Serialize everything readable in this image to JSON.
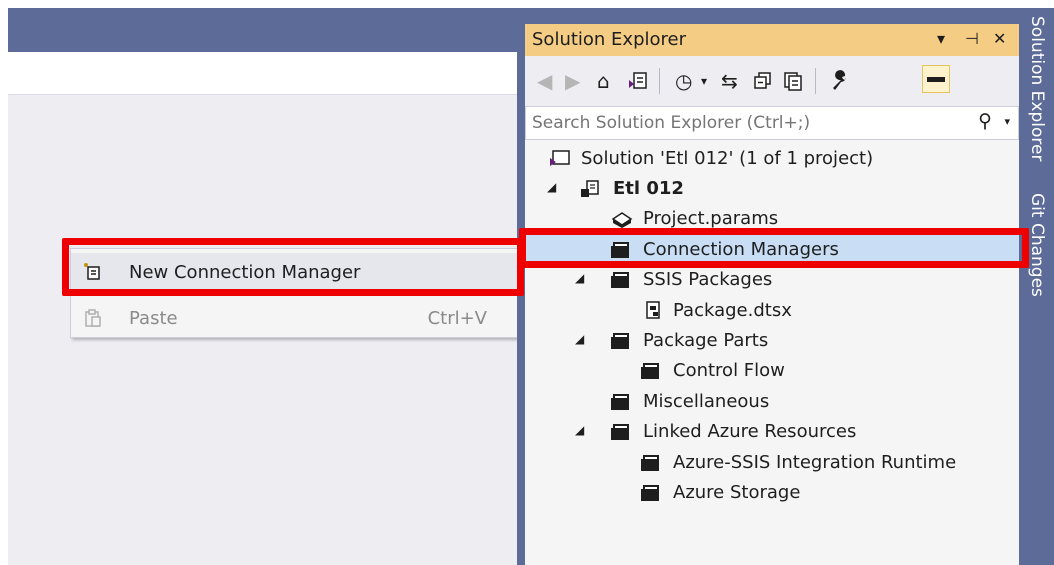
{
  "menu": {
    "items": [
      {
        "label": "New Connection Manager",
        "shortcut": "",
        "icon": "new-connection-icon",
        "enabled": true
      },
      {
        "label": "Paste",
        "shortcut": "Ctrl+V",
        "icon": "paste-icon",
        "enabled": false
      }
    ]
  },
  "solution_explorer": {
    "title": "Solution Explorer",
    "controls": {
      "dropdown": "▾",
      "pin": "⊣",
      "close": "✕"
    },
    "search": {
      "placeholder": "Search Solution Explorer (Ctrl+;)"
    },
    "tree": [
      {
        "label": "Solution 'Etl 012' (1 of 1 project)",
        "icon": "solution-icon"
      },
      {
        "label": "Etl 012",
        "icon": "ssis-project-icon",
        "bold": true,
        "expanded": true
      },
      {
        "label": "Project.params",
        "icon": "params-icon"
      },
      {
        "label": "Connection Managers",
        "icon": "folder-icon",
        "selected": true
      },
      {
        "label": "SSIS Packages",
        "icon": "folder-icon",
        "expanded": true
      },
      {
        "label": "Package.dtsx",
        "icon": "package-icon"
      },
      {
        "label": "Package Parts",
        "icon": "folder-icon",
        "expanded": true
      },
      {
        "label": "Control Flow",
        "icon": "folder-icon"
      },
      {
        "label": "Miscellaneous",
        "icon": "folder-icon"
      },
      {
        "label": "Linked Azure Resources",
        "icon": "folder-icon",
        "expanded": true
      },
      {
        "label": "Azure-SSIS Integration Runtime",
        "icon": "folder-icon"
      },
      {
        "label": "Azure Storage",
        "icon": "folder-icon"
      }
    ]
  },
  "side_tabs": [
    "Solution Explorer",
    "Git Changes"
  ],
  "colors": {
    "frame": "#5d6b99",
    "title_active": "#f5cc84",
    "selection": "#c9def5",
    "highlight": "#ee0000"
  }
}
